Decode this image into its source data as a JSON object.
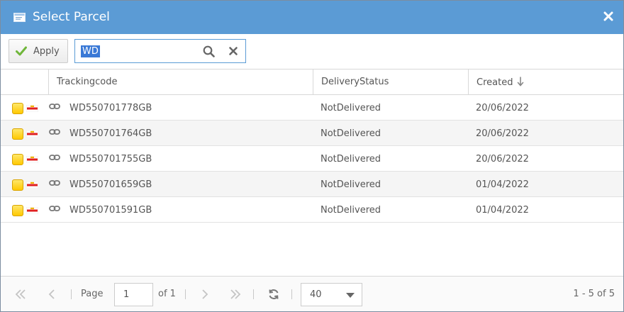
{
  "dialog": {
    "title": "Select Parcel"
  },
  "toolbar": {
    "apply_label": "Apply",
    "search_value": "WD"
  },
  "grid": {
    "columns": [
      "",
      "Trackingcode",
      "DeliveryStatus",
      "Created"
    ],
    "sort_column": "Created",
    "sort_direction": "descending",
    "rows": [
      {
        "trackingcode": "WD550701778GB",
        "status": "NotDelivered",
        "created": "20/06/2022"
      },
      {
        "trackingcode": "WD550701764GB",
        "status": "NotDelivered",
        "created": "20/06/2022"
      },
      {
        "trackingcode": "WD550701755GB",
        "status": "NotDelivered",
        "created": "20/06/2022"
      },
      {
        "trackingcode": "WD550701659GB",
        "status": "NotDelivered",
        "created": "01/04/2022"
      },
      {
        "trackingcode": "WD550701591GB",
        "status": "NotDelivered",
        "created": "01/04/2022"
      }
    ]
  },
  "pager": {
    "page_label": "Page",
    "current_page": "1",
    "of_label": "of 1",
    "page_size": "40",
    "range_label": "1 - 5 of 5"
  },
  "colors": {
    "titlebar": "#5b9bd5",
    "selection": "#3a79d6",
    "row_alt": "#f5f5f5"
  },
  "icons": {
    "title": "window-icon",
    "close": "close-icon",
    "apply": "check-icon",
    "search": "search-icon",
    "clear": "clear-icon",
    "sort": "arrow-down-icon",
    "row_flag": "yellow-square-icon",
    "row_carrier": "royal-mail-icon",
    "row_link": "link-icon",
    "first": "first-page-icon",
    "prev": "prev-page-icon",
    "next": "next-page-icon",
    "last": "last-page-icon",
    "refresh": "refresh-icon"
  }
}
